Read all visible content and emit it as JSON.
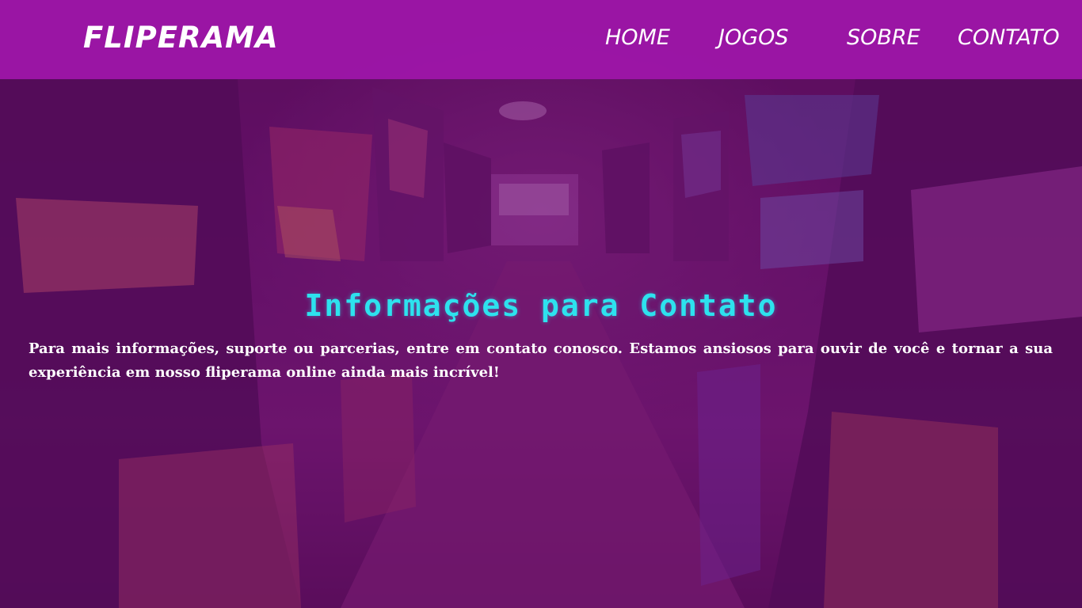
{
  "navbar": {
    "brand": "FLIPERAMA",
    "links": [
      {
        "label": "HOME"
      },
      {
        "label": "JOGOS"
      },
      {
        "label": "SOBRE"
      },
      {
        "label": "CONTATO"
      }
    ]
  },
  "main": {
    "heading": "Informações para Contato",
    "paragraph": "Para mais informações, suporte ou parcerias, entre em contato conosco. Estamos ansiosos para ouvir de você e tornar a sua experiência em nosso fliperama online ainda mais incrível!"
  },
  "colors": {
    "navbar_bg": "#a016aa",
    "heading": "#2de2ee",
    "text": "#ffffff",
    "overlay": "#6e0a6e"
  },
  "background": {
    "description_icon": "arcade-hallway-image"
  }
}
